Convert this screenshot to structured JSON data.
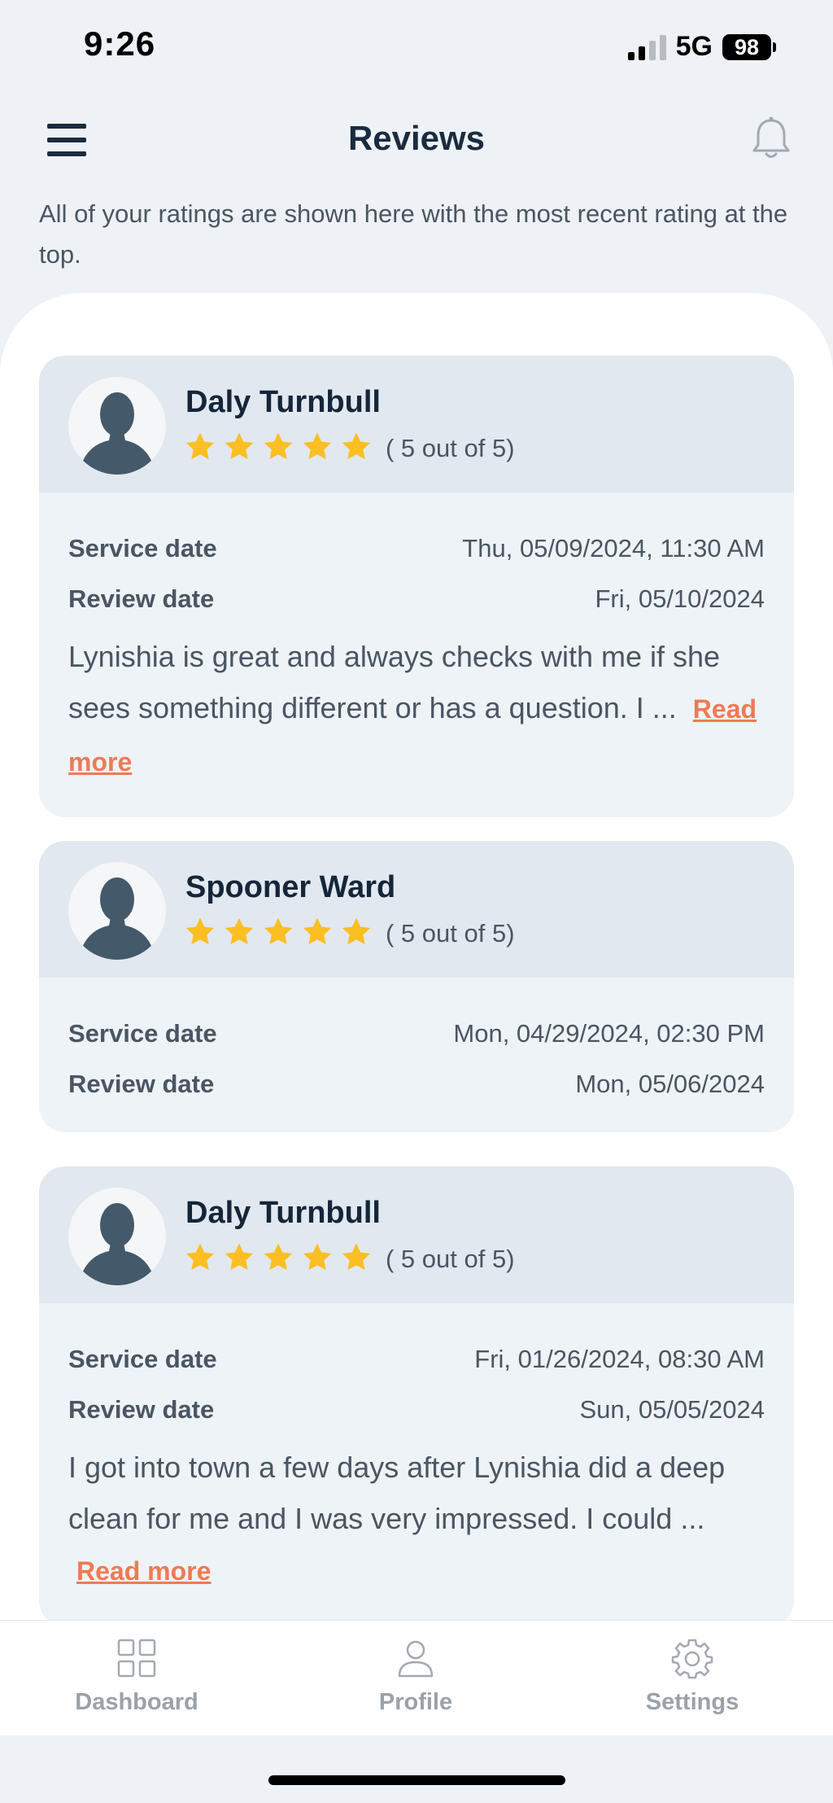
{
  "status_bar": {
    "time": "9:26",
    "network": "5G",
    "battery": "98"
  },
  "header": {
    "title": "Reviews",
    "menu_icon": "hamburger-menu-icon",
    "notification_icon": "bell-icon"
  },
  "intro_text": "All of your ratings are shown here with the most recent rating at the top.",
  "labels": {
    "service_date": "Service date",
    "review_date": "Review date"
  },
  "reviews": [
    {
      "name": "Daly Turnbull",
      "stars": 5,
      "rating_text": "( 5 out of 5)",
      "service_date": "Thu, 05/09/2024, 11:30 AM",
      "review_date": "Fri, 05/10/2024",
      "text": "Lynishia is great and always checks with me if she sees something different or has a question. I ...",
      "read_more": "Read more"
    },
    {
      "name": "Spooner Ward",
      "stars": 5,
      "rating_text": "( 5 out of 5)",
      "service_date": "Mon, 04/29/2024, 02:30 PM",
      "review_date": "Mon, 05/06/2024"
    },
    {
      "name": "Daly Turnbull",
      "stars": 5,
      "rating_text": "( 5 out of 5)",
      "service_date": "Fri, 01/26/2024, 08:30 AM",
      "review_date": "Sun, 05/05/2024",
      "text": "I got into town a few days after Lynishia did a deep clean for me and I was very impressed. I could ...",
      "read_more": "Read more"
    }
  ],
  "bottom_nav": [
    {
      "label": "Dashboard",
      "icon": "grid-icon"
    },
    {
      "label": "Profile",
      "icon": "person-icon"
    },
    {
      "label": "Settings",
      "icon": "gear-icon"
    }
  ],
  "colors": {
    "star": "#fbbf24",
    "accent_link": "#ee7a55",
    "title": "#1a2b40"
  }
}
